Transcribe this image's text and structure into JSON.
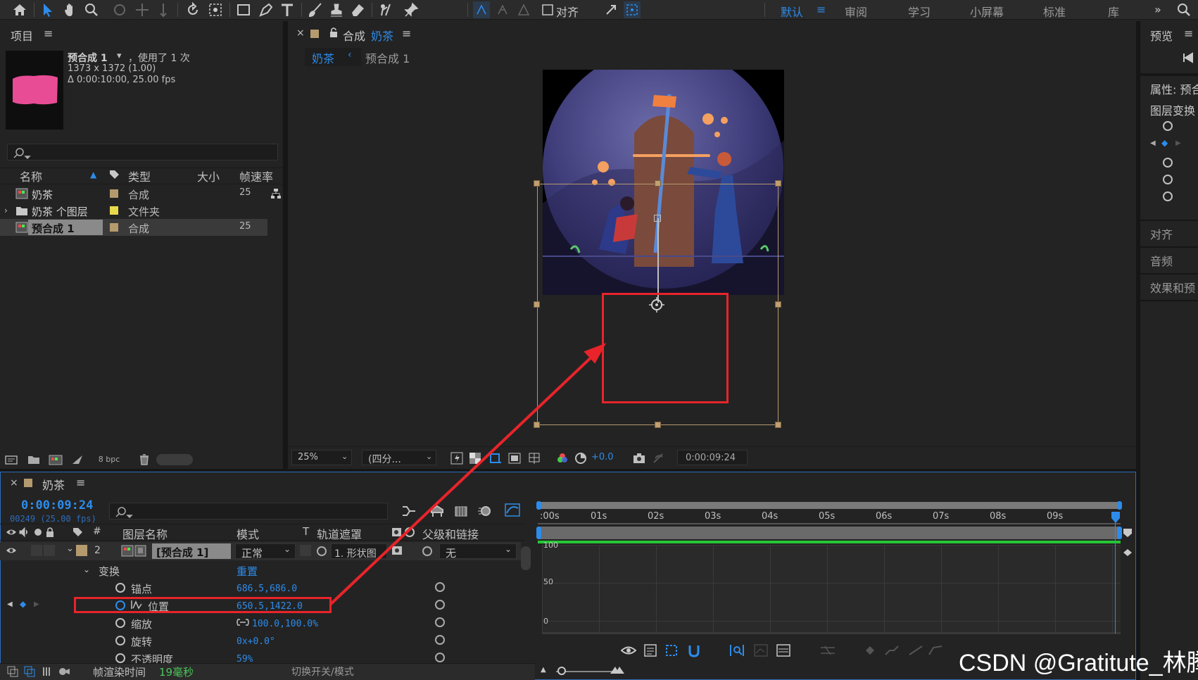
{
  "workspaces": [
    "默认",
    "审阅",
    "学习",
    "小屏幕",
    "标准",
    "库"
  ],
  "toolbar": {
    "align_label": "对齐",
    "overflow": "»"
  },
  "project": {
    "title": "项目",
    "item_name": "预合成 1",
    "item_used": "，使用了 1 次",
    "item_dims": "1373 x 1372 (1.00)",
    "item_duration": "Δ 0:00:10:00, 25.00 fps",
    "columns": [
      "名称",
      "类型",
      "大小",
      "帧速率"
    ],
    "rows": [
      {
        "name": "奶茶",
        "type": "合成",
        "fps": "25"
      },
      {
        "name": "奶茶 个图层",
        "type": "文件夹",
        "fps": ""
      },
      {
        "name": "预合成 1",
        "type": "合成",
        "fps": "25"
      }
    ],
    "bpc": "8 bpc"
  },
  "composition": {
    "title_prefix": "合成",
    "title_name": "奶茶",
    "breadcrumb": [
      "奶茶",
      "预合成 1"
    ],
    "zoom": "25%",
    "resolution": "(四分...",
    "exposure": "+0.0",
    "timecode": "0:00:09:24"
  },
  "right_panel": {
    "preview": "预览",
    "properties": "属性: 预合",
    "layer_transform": "图层变换",
    "align": "对齐",
    "audio": "音频",
    "effects": "效果和预"
  },
  "timeline": {
    "comp_name": "奶茶",
    "timecode": "0:00:09:24",
    "frame_info": "00249 (25.00 fps)",
    "headers": {
      "num": "#",
      "layer_name": "图层名称",
      "mode": "模式",
      "t": "T",
      "track_matte": "轨道遮罩",
      "parent": "父级和链接"
    },
    "layer": {
      "index": "2",
      "name": "[预合成 1]",
      "mode": "正常",
      "matte": "1. 形状图",
      "parent": "无"
    },
    "transform_label": "变换",
    "reset_label": "重置",
    "properties": [
      {
        "name": "锚点",
        "value": "686.5,686.0"
      },
      {
        "name": "位置",
        "value": "650.5,1422.0"
      },
      {
        "name": "缩放",
        "value": "100.0,100.0%"
      },
      {
        "name": "旋转",
        "value": "0x+0.0°"
      },
      {
        "name": "不透明度",
        "value": "59%"
      }
    ],
    "ruler": [
      ":00s",
      "01s",
      "02s",
      "03s",
      "04s",
      "05s",
      "06s",
      "07s",
      "08s",
      "09s"
    ],
    "graph_labels": [
      "100",
      "50",
      "0"
    ],
    "render_time_label": "帧渲染时间",
    "render_time_value": "19毫秒",
    "toggle_label": "切换开关/模式"
  },
  "watermark": "CSDN @Gratitute_林腾",
  "colors": {
    "accent": "#2d8ceb",
    "annotation": "#e8242a",
    "label_tan": "#b59a6e"
  }
}
